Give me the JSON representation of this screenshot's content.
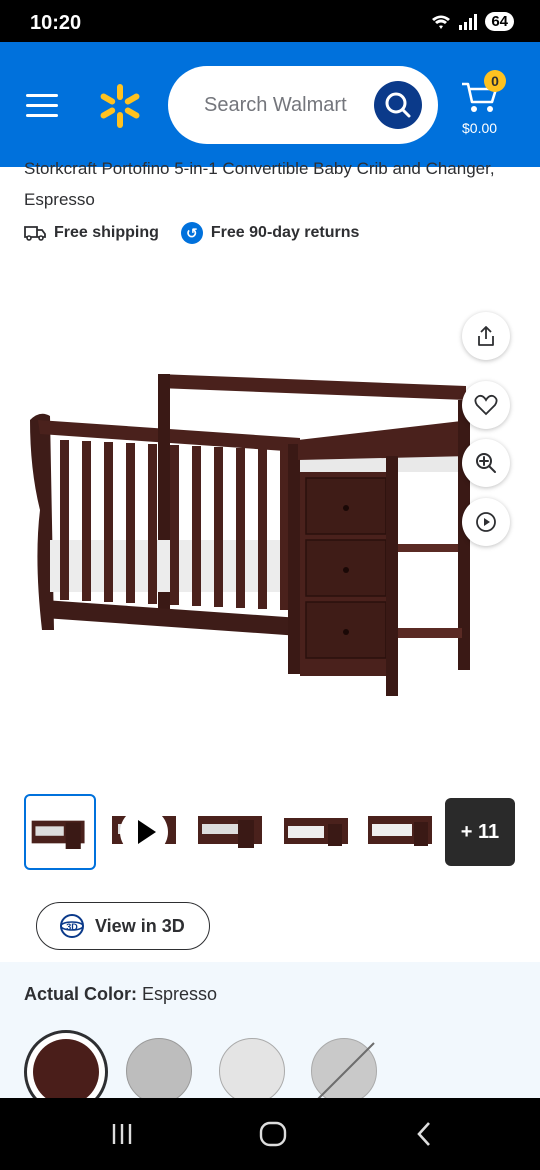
{
  "status_bar": {
    "time": "10:20",
    "battery": "64"
  },
  "header": {
    "search_placeholder": "Search Walmart",
    "cart_count": "0",
    "cart_total": "$0.00",
    "brand_color": "#0071dc",
    "accent_color": "#ffc220"
  },
  "product": {
    "title_partial": "Storkcraft Portofino 5-in-1 Convertible Baby Crib and Changer, Espresso",
    "free_shipping": "Free shipping",
    "free_returns": "Free 90-day returns"
  },
  "gallery": {
    "more_count": "+ 11",
    "view_3d_label": "View in 3D",
    "thumbnail_count": 6
  },
  "color_options": {
    "label": "Actual Color:",
    "selected_value": "Espresso",
    "swatches": [
      {
        "name": "Espresso",
        "color": "#4a1e1a",
        "selected": true
      },
      {
        "name": "Gray",
        "color": "#bdbdbd",
        "selected": false
      },
      {
        "name": "White",
        "color": "#e4e4e4",
        "selected": false
      },
      {
        "name": "Unavailable",
        "color": "#c9c9c9",
        "selected": false
      }
    ]
  },
  "icons": [
    "wifi-icon",
    "signal-icon",
    "menu-icon",
    "walmart-spark-icon",
    "search-icon",
    "cart-icon",
    "truck-icon",
    "returns-icon",
    "share-icon",
    "heart-icon",
    "zoom-icon",
    "play-icon",
    "3d-icon",
    "recent-apps-icon",
    "home-icon",
    "back-icon"
  ]
}
